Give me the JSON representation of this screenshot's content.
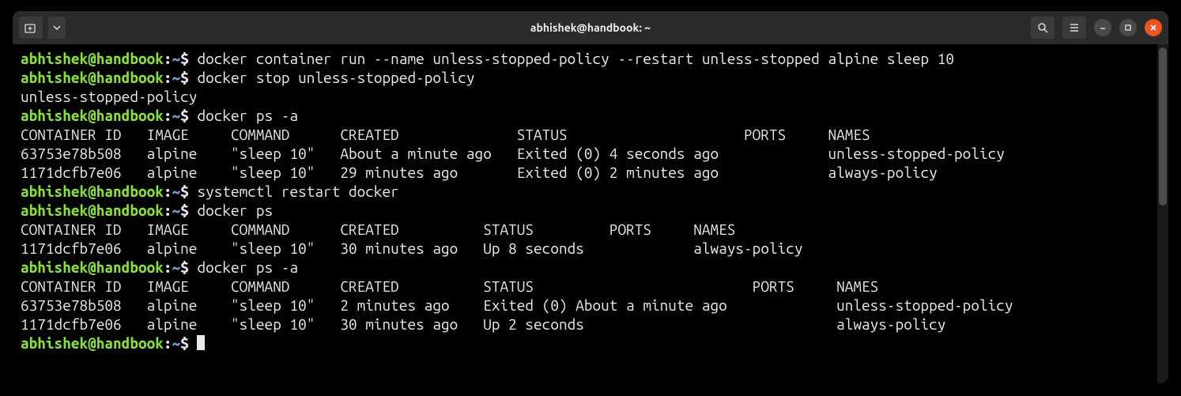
{
  "titlebar": {
    "title": "abhishek@handbook: ~"
  },
  "prompt": {
    "user_host": "abhishek@handbook",
    "colon": ":",
    "path": "~",
    "dollar": "$"
  },
  "session": [
    {
      "type": "cmd",
      "text": " docker container run --name unless-stopped-policy --restart unless-stopped alpine sleep 10"
    },
    {
      "type": "cmd",
      "text": " docker stop unless-stopped-policy"
    },
    {
      "type": "out",
      "text": "unless-stopped-policy"
    },
    {
      "type": "cmd",
      "text": " docker ps -a"
    },
    {
      "type": "out",
      "text": "CONTAINER ID   IMAGE     COMMAND      CREATED              STATUS                     PORTS     NAMES"
    },
    {
      "type": "out",
      "text": "63753e78b508   alpine    \"sleep 10\"   About a minute ago   Exited (0) 4 seconds ago             unless-stopped-policy"
    },
    {
      "type": "out",
      "text": "1171dcfb7e06   alpine    \"sleep 10\"   29 minutes ago       Exited (0) 2 minutes ago             always-policy"
    },
    {
      "type": "cmd",
      "text": " systemctl restart docker"
    },
    {
      "type": "cmd",
      "text": " docker ps"
    },
    {
      "type": "out",
      "text": "CONTAINER ID   IMAGE     COMMAND      CREATED          STATUS         PORTS     NAMES"
    },
    {
      "type": "out",
      "text": "1171dcfb7e06   alpine    \"sleep 10\"   30 minutes ago   Up 8 seconds             always-policy"
    },
    {
      "type": "cmd",
      "text": " docker ps -a"
    },
    {
      "type": "out",
      "text": "CONTAINER ID   IMAGE     COMMAND      CREATED          STATUS                          PORTS     NAMES"
    },
    {
      "type": "out",
      "text": "63753e78b508   alpine    \"sleep 10\"   2 minutes ago    Exited (0) About a minute ago             unless-stopped-policy"
    },
    {
      "type": "out",
      "text": "1171dcfb7e06   alpine    \"sleep 10\"   30 minutes ago   Up 2 seconds                              always-policy"
    },
    {
      "type": "cmd",
      "text": " ",
      "cursor": true
    }
  ]
}
